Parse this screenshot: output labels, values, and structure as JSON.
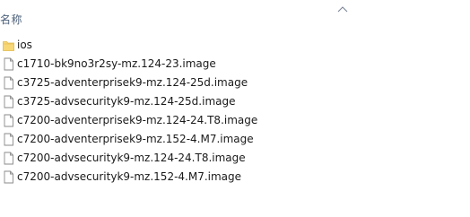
{
  "header": {
    "name_column": "名称",
    "sort_icon": "chevron-up-icon"
  },
  "files": [
    {
      "name": "ios",
      "type": "folder",
      "icon": "folder-icon"
    },
    {
      "name": "c1710-bk9no3r2sy-mz.124-23.image",
      "type": "file",
      "icon": "file-icon"
    },
    {
      "name": "c3725-adventerprisek9-mz.124-25d.image",
      "type": "file",
      "icon": "file-icon"
    },
    {
      "name": "c3725-advsecurityk9-mz.124-25d.image",
      "type": "file",
      "icon": "file-icon"
    },
    {
      "name": "c7200-adventerprisek9-mz.124-24.T8.image",
      "type": "file",
      "icon": "file-icon"
    },
    {
      "name": "c7200-adventerprisek9-mz.152-4.M7.image",
      "type": "file",
      "icon": "file-icon"
    },
    {
      "name": "c7200-advsecurityk9-mz.124-24.T8.image",
      "type": "file",
      "icon": "file-icon"
    },
    {
      "name": "c7200-advsecurityk9-mz.152-4.M7.image",
      "type": "file",
      "icon": "file-icon"
    }
  ],
  "colors": {
    "folder": "#f8d775",
    "folder_dark": "#e0b94a",
    "file_outline": "#8a8a8a",
    "header_text": "#4c607a"
  }
}
